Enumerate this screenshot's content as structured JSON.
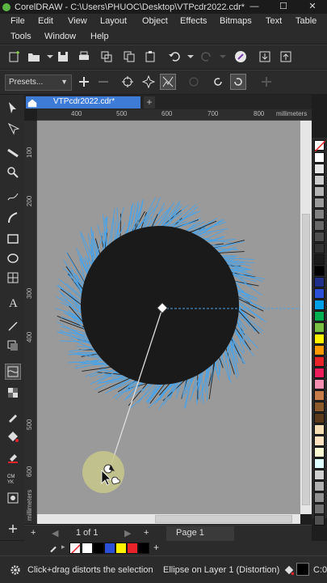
{
  "titlebar": {
    "title": "CorelDRAW - C:\\Users\\PHUOC\\Desktop\\VTPcdr2022.cdr*",
    "minimize": "—",
    "maximize": "☐",
    "close": "✕"
  },
  "menu": {
    "file": "File",
    "edit": "Edit",
    "view": "View",
    "layout": "Layout",
    "object": "Object",
    "effects": "Effects",
    "bitmaps": "Bitmaps",
    "text": "Text",
    "table": "Table",
    "tools": "Tools",
    "window": "Window",
    "help": "Help"
  },
  "propbar": {
    "presets": "Presets..."
  },
  "tabs": {
    "document": "VTPcdr2022.cdr*",
    "add": "+"
  },
  "ruler": {
    "units": "millimeters",
    "top_ticks": [
      "400",
      "500",
      "600",
      "700",
      "800"
    ],
    "left_ticks": [
      "100",
      "200",
      "300",
      "400",
      "500",
      "600"
    ],
    "left_units": "millimeters"
  },
  "pagebar": {
    "add_left": "+",
    "counter": "1  of  1",
    "add_right": "+",
    "page_label": "Page 1"
  },
  "statusbar": {
    "hint": "Click+drag distorts the selection",
    "object_info": "Ellipse on Layer 1 (Distortion)",
    "color_code": "C:0"
  },
  "colors": {
    "accent": "#3d7bd6",
    "canvas": "#9a9a9a",
    "hair": "#4aa3e8",
    "shape": "#1a1a1a"
  },
  "palette_colors": [
    "#ffffff",
    "#e6e6e6",
    "#cccccc",
    "#b3b3b3",
    "#999999",
    "#808080",
    "#666666",
    "#4d4d4d",
    "#333333",
    "#1a1a1a",
    "#000000",
    "#1f2f8a",
    "#2b4fd6",
    "#00a0e9",
    "#00b050",
    "#7ac143",
    "#fff200",
    "#ff9900",
    "#e8232a",
    "#ed1c5a",
    "#f48fb1",
    "#c77c4a",
    "#8b5a2b",
    "#5a3a1a",
    "#f5deb3",
    "#ffe4c4",
    "#fafad2",
    "#e0ffff",
    "#d0d0d0",
    "#b0b0b0",
    "#909090",
    "#707070",
    "#505050"
  ],
  "doc_palette": [
    "#ffffff",
    "#000000",
    "#2b4fd6",
    "#fff200",
    "#e8232a",
    "#000000"
  ]
}
